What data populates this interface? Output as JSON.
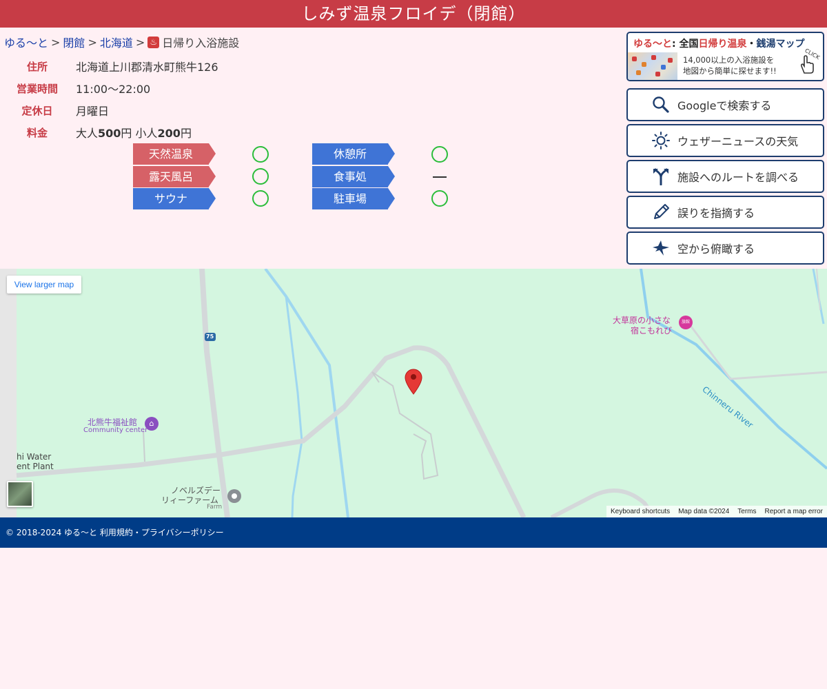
{
  "title": "しみず温泉フロイデ（閉館）",
  "breadcrumb": {
    "home": "ゆる〜と",
    "closed": "閉館",
    "region": "北海道",
    "current": "日帰り入浴施設",
    "sep": ">"
  },
  "info": [
    {
      "label": "住所",
      "value": "北海道上川郡清水町熊牛126"
    },
    {
      "label": "営業時間",
      "value": "11:00〜22:00"
    },
    {
      "label": "定休日",
      "value": "月曜日"
    },
    {
      "label": "料金",
      "adult_prefix": "大人",
      "adult_price": "500",
      "yen1": "円 ",
      "child_prefix": "小人",
      "child_price": "200",
      "yen2": "円"
    }
  ],
  "facilities": [
    {
      "name": "天然温泉",
      "color": "#d66167",
      "status": "circle"
    },
    {
      "name": "露天風呂",
      "color": "#d66167",
      "status": "circle"
    },
    {
      "name": "サウナ",
      "color": "#3f74d6",
      "status": "circle"
    },
    {
      "name": "休憩所",
      "color": "#3f74d6",
      "status": "circle"
    },
    {
      "name": "食事処",
      "color": "#3f74d6",
      "status": "dash"
    },
    {
      "name": "駐車場",
      "color": "#3f74d6",
      "status": "circle"
    }
  ],
  "banner": {
    "brand": "ゆる〜と",
    "colon": ":",
    "zenkoku": "全国",
    "higaeri": "日帰り温泉",
    "dot": "・",
    "sento": "銭湯マップ",
    "line1": "14,000以上の入浴施設を",
    "line2": "地図から簡単に探せます!!",
    "click": "CLICK"
  },
  "actions": [
    {
      "label": "Googleで検索する",
      "icon": "search-icon"
    },
    {
      "label": "ウェザーニュースの天気",
      "icon": "sun-icon"
    },
    {
      "label": "施設へのルートを調べる",
      "icon": "route-icon"
    },
    {
      "label": "誤りを指摘する",
      "icon": "pencil-icon"
    },
    {
      "label": "空から俯瞰する",
      "icon": "bird-icon"
    }
  ],
  "map": {
    "larger_map": "View larger map",
    "road_number": "75",
    "inn_name_1": "大草原の小さな",
    "inn_name_2": "宿こもれび",
    "inn_badge": "旅館",
    "community_name": "北熊牛福祉館",
    "community_type": "Community center",
    "water_1": "hi Water",
    "water_2": "ent Plant",
    "farm_name_1": "ノベルズデー",
    "farm_name_2": "リィーファーム",
    "farm_type": "Farm",
    "river": "Chinneru River",
    "keyboard": "Keyboard shortcuts",
    "map_data": "Map data ©2024",
    "terms": "Terms",
    "report": "Report a map error"
  },
  "footer": "© 2018-2024 ゆる〜と 利用規約・プライバシーポリシー"
}
